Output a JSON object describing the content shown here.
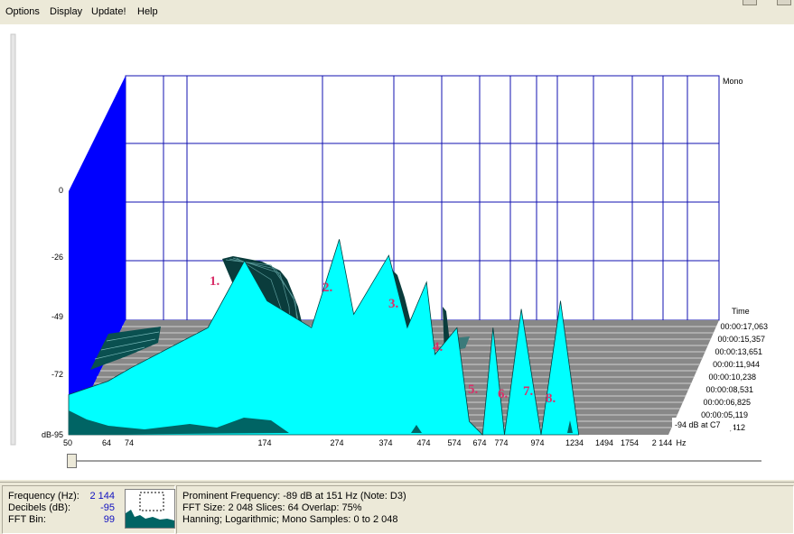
{
  "menu": {
    "options": "Options",
    "display": "Display",
    "update": "Update!",
    "help": "Help"
  },
  "channel_label": "Mono",
  "time_header": "Time",
  "time_labels": [
    "00:00:17,063",
    "00:00:15,357",
    "00:00:13,651",
    "00:00:11,944",
    "00:00:10,238",
    "00:00:08,531",
    "00:00:06,825",
    "00:00:05,119",
    "00:00:03,412"
  ],
  "db_readout": "-94 dB at C7",
  "hz_unit": "Hz",
  "db_unit": "dB",
  "peak_labels": [
    "1.",
    "2.",
    "3.",
    "4.",
    "5.",
    "6.",
    "7.",
    "8."
  ],
  "colors": {
    "spectrum_fill": "#00ffff",
    "grid_blue": "#1010b0",
    "side_wall": "#0000ff",
    "ridge_dark": "#006464",
    "peak_label": "#d9306a",
    "value_blue": "#1010c0"
  },
  "chart_data": {
    "type": "area",
    "x_ticks": [
      "50",
      "64",
      "74",
      "174",
      "274",
      "374",
      "474",
      "574",
      "674",
      "774",
      "974",
      "1234",
      "1494",
      "1754",
      "2 144"
    ],
    "y_ticks": [
      "0",
      "-26",
      "-49",
      "-72",
      "-95"
    ],
    "ylim": [
      -95,
      0
    ],
    "x_scale": "log",
    "front_slice_series": {
      "x": [
        50,
        64,
        74,
        120,
        151,
        174,
        230,
        274,
        300,
        374,
        420,
        474,
        500,
        574,
        620,
        674,
        720,
        774,
        860,
        974,
        1100,
        1234
      ],
      "db": [
        -80,
        -75,
        -70,
        -55,
        -30,
        -45,
        -55,
        -22,
        -50,
        -28,
        -55,
        -38,
        -65,
        -55,
        -90,
        -95,
        -55,
        -95,
        -48,
        -95,
        -45,
        -95
      ]
    }
  },
  "status": {
    "frequency_label": "Frequency (Hz):",
    "frequency_value": "2 144",
    "decibels_label": "Decibels (dB):",
    "decibels_value": "-95",
    "fft_bin_label": "FFT Bin:",
    "fft_bin_value": "99",
    "prominent": "Prominent Frequency: -89 dB at 151 Hz (Note: D3)",
    "fft_info": "FFT Size: 2 048  Slices: 64  Overlap: 75%",
    "window_info": "Hanning; Logarithmic; Mono  Samples: 0 to 2 048"
  }
}
